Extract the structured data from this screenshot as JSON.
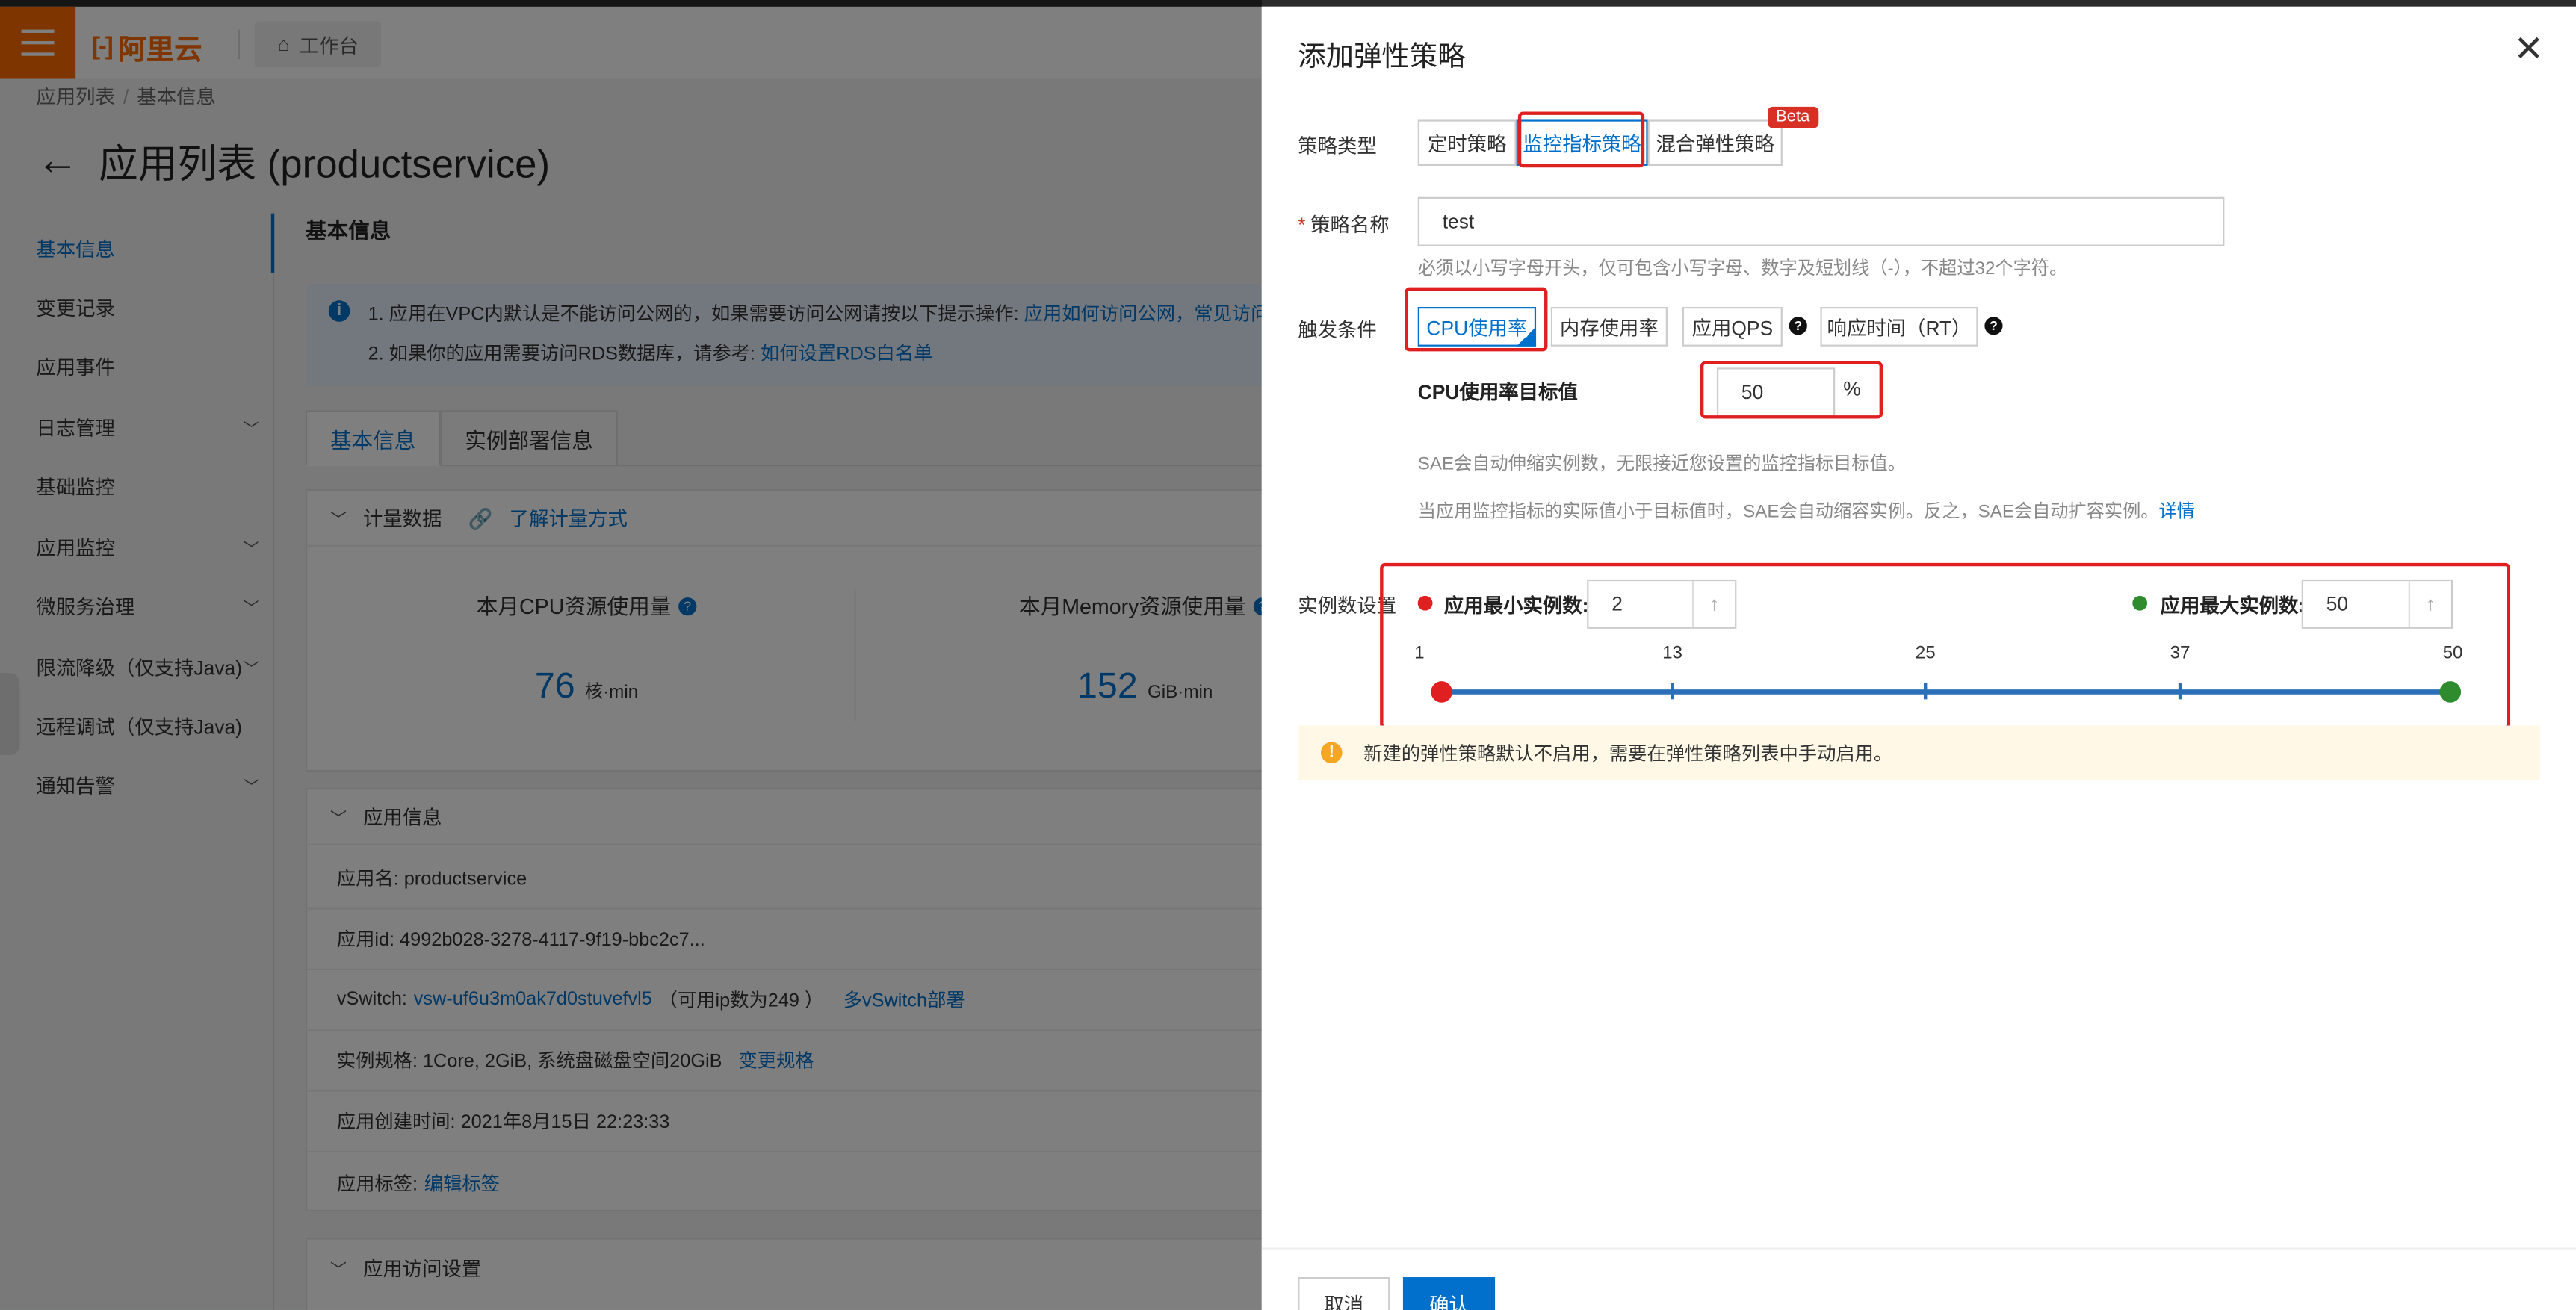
{
  "header": {
    "logo_text": "阿里云",
    "workbench_label": "工作台"
  },
  "breadcrumb": [
    "应用列表",
    "基本信息"
  ],
  "page_title": "应用列表 (productservice)",
  "sidebar": {
    "items": [
      {
        "label": "基本信息"
      },
      {
        "label": "变更记录"
      },
      {
        "label": "应用事件"
      },
      {
        "label": "日志管理"
      },
      {
        "label": "基础监控"
      },
      {
        "label": "应用监控"
      },
      {
        "label": "微服务治理"
      },
      {
        "label": "限流降级（仅支持Java)"
      },
      {
        "label": "远程调试（仅支持Java)"
      },
      {
        "label": "通知告警"
      }
    ]
  },
  "main": {
    "section_title": "基本信息",
    "notice": {
      "line1": "1. 应用在VPC内默认是不能访问公网的，如果需要访问公网请按以下提示操作: ",
      "line1_link": "应用如何访问公网，常见访问公网",
      "line2": "2. 如果你的应用需要访问RDS数据库，请参考: ",
      "line2_link": "如何设置RDS白名单"
    },
    "tabs": [
      {
        "label": "基本信息"
      },
      {
        "label": "实例部署信息"
      }
    ],
    "metering": {
      "header": "计量数据",
      "link": "了解计量方式",
      "cpu_label": "本月CPU资源使用量",
      "cpu_value": "76",
      "cpu_unit": "核·min",
      "mem_label": "本月Memory资源使用量",
      "mem_value": "152",
      "mem_unit": "GiB·min"
    },
    "app_info": {
      "header": "应用信息",
      "name": "应用名: productservice",
      "id": "应用id: 4992b028-3278-4117-9f19-bbc2c7...",
      "vswitch_label": "vSwitch: ",
      "vswitch_link": "vsw-uf6u3m0ak7d0stuvefvl5",
      "vswitch_ip": "（可用ip数为249 ）",
      "vswitch_deploy": "多vSwitch部署",
      "spec": "实例规格: 1Core, 2GiB, 系统盘磁盘空间20GiB",
      "spec_change": "变更规格",
      "created": "应用创建时间: 2021年8月15日 22:23:33",
      "tags_label": "应用标签: ",
      "tags_link": "编辑标签"
    },
    "access": {
      "header": "应用访问设置"
    }
  },
  "drawer": {
    "title": "添加弹性策略",
    "policy_type_label": "策略类型",
    "policy_types": [
      "定时策略",
      "监控指标策略",
      "混合弹性策略"
    ],
    "beta": "Beta",
    "name_label": "策略名称",
    "name_value": "test",
    "name_hint": "必须以小写字母开头，仅可包含小写字母、数字及短划线（-），不超过32个字符。",
    "trigger_label": "触发条件",
    "triggers": [
      "CPU使用率",
      "内存使用率",
      "应用QPS",
      "响应时间（RT）"
    ],
    "cpu_target_label": "CPU使用率目标值",
    "cpu_target_value": "50",
    "cpu_target_unit": "%",
    "hint1": "SAE会自动伸缩实例数，无限接近您设置的监控指标目标值。",
    "hint2": "当应用监控指标的实际值小于目标值时，SAE会自动缩容实例。反之，SAE会自动扩容实例。",
    "hint2_link": "详情",
    "instances_label": "实例数设置",
    "min_label": "应用最小实例数:",
    "min_value": "2",
    "max_label": "应用最大实例数:",
    "max_value": "50",
    "slider_ticks": [
      "1",
      "13",
      "25",
      "37",
      "50"
    ],
    "slider_range": {
      "min": 1,
      "max": 50,
      "low": 1,
      "high": 50
    },
    "warning": "新建的弹性策略默认不启用，需要在弹性策略列表中手动启用。",
    "cancel": "取消",
    "confirm": "确认"
  },
  "colors": {
    "brand": "#ff6a00",
    "link": "#0070cc",
    "highlight": "#e02020",
    "min_dot": "#e02020",
    "max_dot": "#2e8b2e"
  }
}
